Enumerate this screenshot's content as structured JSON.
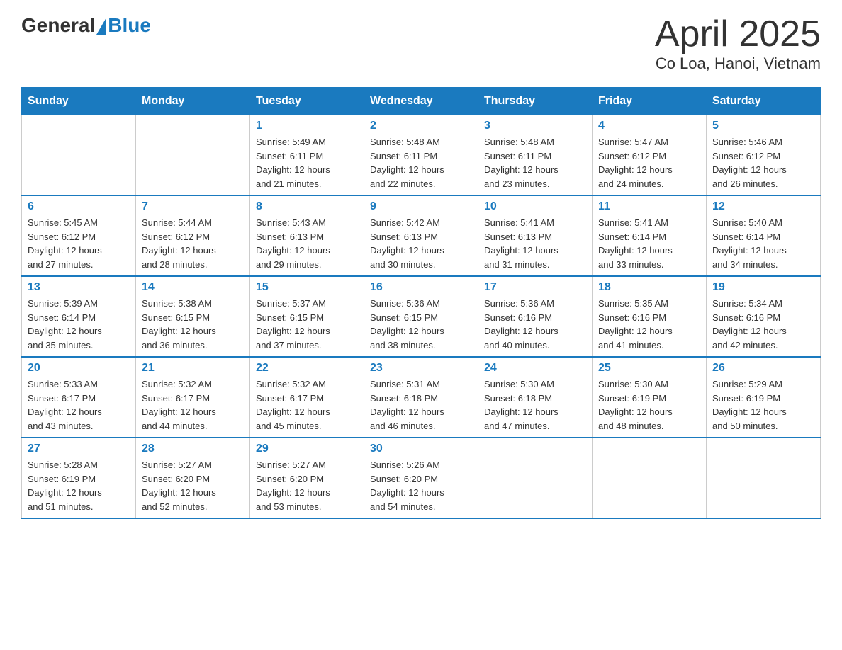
{
  "header": {
    "logo_general": "General",
    "logo_blue": "Blue",
    "title": "April 2025",
    "subtitle": "Co Loa, Hanoi, Vietnam"
  },
  "weekdays": [
    "Sunday",
    "Monday",
    "Tuesday",
    "Wednesday",
    "Thursday",
    "Friday",
    "Saturday"
  ],
  "weeks": [
    [
      {
        "day": "",
        "info": ""
      },
      {
        "day": "",
        "info": ""
      },
      {
        "day": "1",
        "info": "Sunrise: 5:49 AM\nSunset: 6:11 PM\nDaylight: 12 hours\nand 21 minutes."
      },
      {
        "day": "2",
        "info": "Sunrise: 5:48 AM\nSunset: 6:11 PM\nDaylight: 12 hours\nand 22 minutes."
      },
      {
        "day": "3",
        "info": "Sunrise: 5:48 AM\nSunset: 6:11 PM\nDaylight: 12 hours\nand 23 minutes."
      },
      {
        "day": "4",
        "info": "Sunrise: 5:47 AM\nSunset: 6:12 PM\nDaylight: 12 hours\nand 24 minutes."
      },
      {
        "day": "5",
        "info": "Sunrise: 5:46 AM\nSunset: 6:12 PM\nDaylight: 12 hours\nand 26 minutes."
      }
    ],
    [
      {
        "day": "6",
        "info": "Sunrise: 5:45 AM\nSunset: 6:12 PM\nDaylight: 12 hours\nand 27 minutes."
      },
      {
        "day": "7",
        "info": "Sunrise: 5:44 AM\nSunset: 6:12 PM\nDaylight: 12 hours\nand 28 minutes."
      },
      {
        "day": "8",
        "info": "Sunrise: 5:43 AM\nSunset: 6:13 PM\nDaylight: 12 hours\nand 29 minutes."
      },
      {
        "day": "9",
        "info": "Sunrise: 5:42 AM\nSunset: 6:13 PM\nDaylight: 12 hours\nand 30 minutes."
      },
      {
        "day": "10",
        "info": "Sunrise: 5:41 AM\nSunset: 6:13 PM\nDaylight: 12 hours\nand 31 minutes."
      },
      {
        "day": "11",
        "info": "Sunrise: 5:41 AM\nSunset: 6:14 PM\nDaylight: 12 hours\nand 33 minutes."
      },
      {
        "day": "12",
        "info": "Sunrise: 5:40 AM\nSunset: 6:14 PM\nDaylight: 12 hours\nand 34 minutes."
      }
    ],
    [
      {
        "day": "13",
        "info": "Sunrise: 5:39 AM\nSunset: 6:14 PM\nDaylight: 12 hours\nand 35 minutes."
      },
      {
        "day": "14",
        "info": "Sunrise: 5:38 AM\nSunset: 6:15 PM\nDaylight: 12 hours\nand 36 minutes."
      },
      {
        "day": "15",
        "info": "Sunrise: 5:37 AM\nSunset: 6:15 PM\nDaylight: 12 hours\nand 37 minutes."
      },
      {
        "day": "16",
        "info": "Sunrise: 5:36 AM\nSunset: 6:15 PM\nDaylight: 12 hours\nand 38 minutes."
      },
      {
        "day": "17",
        "info": "Sunrise: 5:36 AM\nSunset: 6:16 PM\nDaylight: 12 hours\nand 40 minutes."
      },
      {
        "day": "18",
        "info": "Sunrise: 5:35 AM\nSunset: 6:16 PM\nDaylight: 12 hours\nand 41 minutes."
      },
      {
        "day": "19",
        "info": "Sunrise: 5:34 AM\nSunset: 6:16 PM\nDaylight: 12 hours\nand 42 minutes."
      }
    ],
    [
      {
        "day": "20",
        "info": "Sunrise: 5:33 AM\nSunset: 6:17 PM\nDaylight: 12 hours\nand 43 minutes."
      },
      {
        "day": "21",
        "info": "Sunrise: 5:32 AM\nSunset: 6:17 PM\nDaylight: 12 hours\nand 44 minutes."
      },
      {
        "day": "22",
        "info": "Sunrise: 5:32 AM\nSunset: 6:17 PM\nDaylight: 12 hours\nand 45 minutes."
      },
      {
        "day": "23",
        "info": "Sunrise: 5:31 AM\nSunset: 6:18 PM\nDaylight: 12 hours\nand 46 minutes."
      },
      {
        "day": "24",
        "info": "Sunrise: 5:30 AM\nSunset: 6:18 PM\nDaylight: 12 hours\nand 47 minutes."
      },
      {
        "day": "25",
        "info": "Sunrise: 5:30 AM\nSunset: 6:19 PM\nDaylight: 12 hours\nand 48 minutes."
      },
      {
        "day": "26",
        "info": "Sunrise: 5:29 AM\nSunset: 6:19 PM\nDaylight: 12 hours\nand 50 minutes."
      }
    ],
    [
      {
        "day": "27",
        "info": "Sunrise: 5:28 AM\nSunset: 6:19 PM\nDaylight: 12 hours\nand 51 minutes."
      },
      {
        "day": "28",
        "info": "Sunrise: 5:27 AM\nSunset: 6:20 PM\nDaylight: 12 hours\nand 52 minutes."
      },
      {
        "day": "29",
        "info": "Sunrise: 5:27 AM\nSunset: 6:20 PM\nDaylight: 12 hours\nand 53 minutes."
      },
      {
        "day": "30",
        "info": "Sunrise: 5:26 AM\nSunset: 6:20 PM\nDaylight: 12 hours\nand 54 minutes."
      },
      {
        "day": "",
        "info": ""
      },
      {
        "day": "",
        "info": ""
      },
      {
        "day": "",
        "info": ""
      }
    ]
  ]
}
